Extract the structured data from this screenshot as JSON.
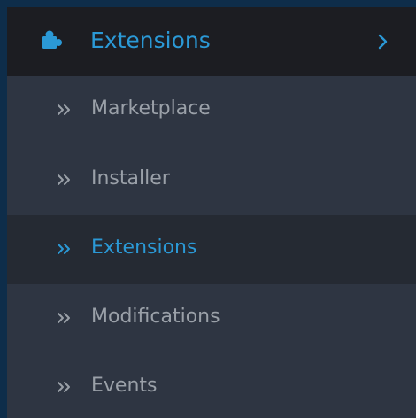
{
  "colors": {
    "page_border": "#0e2d4a",
    "menu_background": "#2e3542",
    "header_background": "#1c1d22",
    "active_item_background": "#252a33",
    "accent": "#2b99d6",
    "inactive_text": "#9aa0a8"
  },
  "menu": {
    "title": "Extensions",
    "icon": "puzzle-icon",
    "expand_icon": "chevron-right-icon",
    "items": [
      {
        "label": "Marketplace",
        "active": false,
        "icon": "double-chevron-right-icon"
      },
      {
        "label": "Installer",
        "active": false,
        "icon": "double-chevron-right-icon"
      },
      {
        "label": "Extensions",
        "active": true,
        "icon": "double-chevron-right-icon"
      },
      {
        "label": "Modifications",
        "active": false,
        "icon": "double-chevron-right-icon"
      },
      {
        "label": "Events",
        "active": false,
        "icon": "double-chevron-right-icon"
      }
    ]
  }
}
